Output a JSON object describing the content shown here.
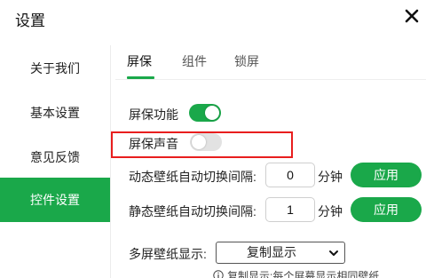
{
  "window": {
    "title": "设置"
  },
  "sidebar": {
    "items": [
      {
        "label": "关于我们"
      },
      {
        "label": "基本设置"
      },
      {
        "label": "意见反馈"
      },
      {
        "label": "控件设置"
      }
    ]
  },
  "tabs": [
    {
      "label": "屏保"
    },
    {
      "label": "组件"
    },
    {
      "label": "锁屏"
    }
  ],
  "settings": {
    "screensaver_function": {
      "label": "屏保功能",
      "enabled": true
    },
    "screensaver_sound": {
      "label": "屏保声音",
      "enabled": false
    },
    "dynamic_interval": {
      "label": "动态壁纸自动切换间隔:",
      "value": "0",
      "unit": "分钟",
      "button": "应用"
    },
    "static_interval": {
      "label": "静态壁纸自动切换间隔:",
      "value": "1",
      "unit": "分钟",
      "button": "应用"
    },
    "multi_screen": {
      "label": "多屏壁纸显示:",
      "selected": "复制显示"
    },
    "note": "复制显示:每个屏幕显示相同壁纸"
  },
  "colors": {
    "accent": "#1aa84a",
    "highlight": "#e81e1e"
  },
  "icons": {
    "close": "close-icon",
    "dropdown": "chevron-down-icon",
    "info": "info-icon"
  }
}
